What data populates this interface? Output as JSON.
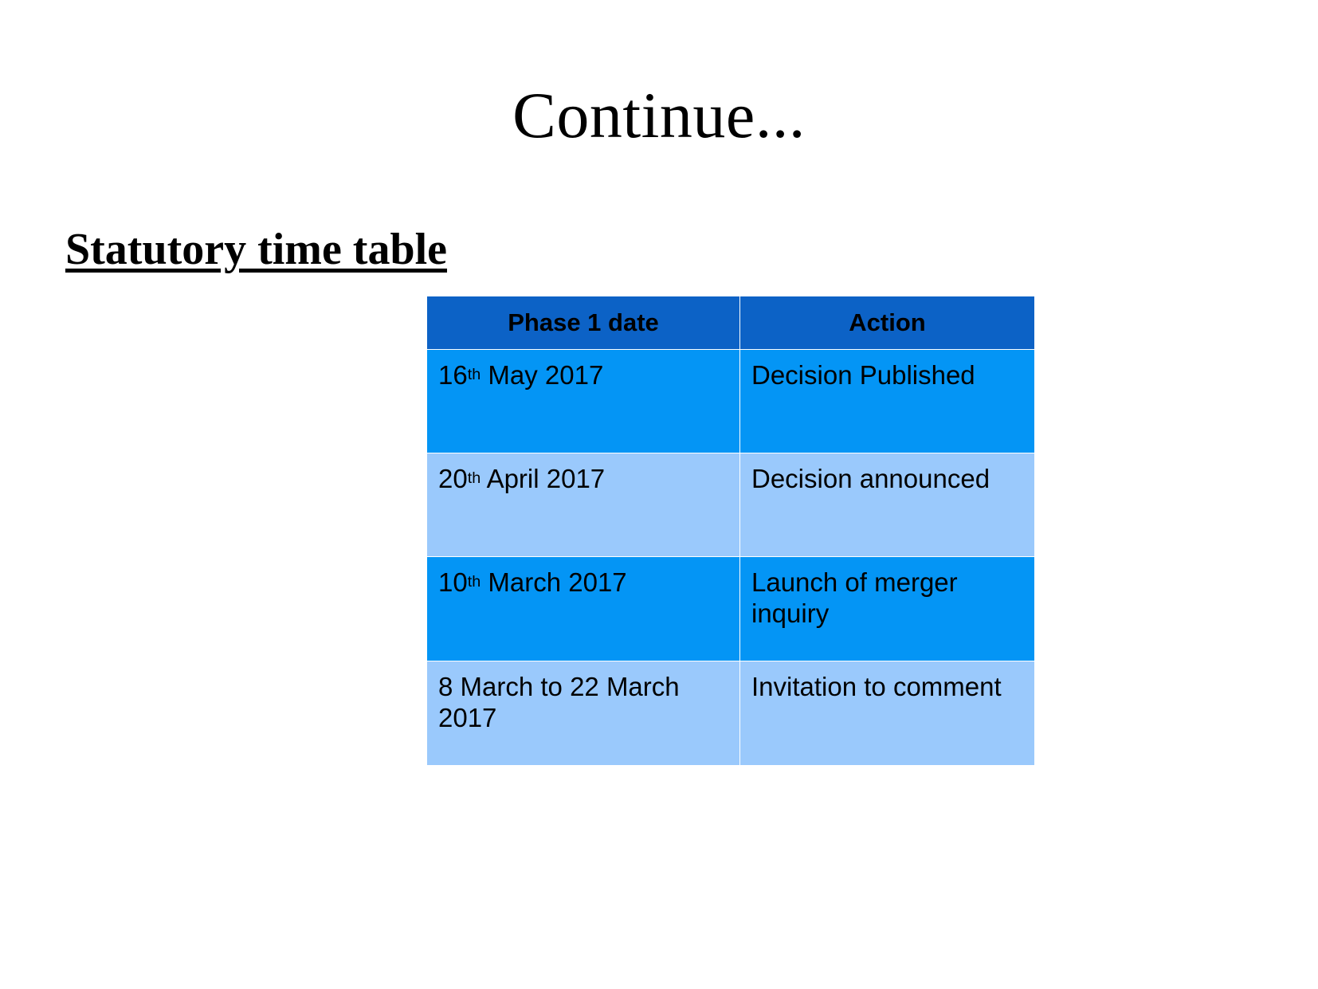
{
  "slide": {
    "title": "Continue...",
    "section_heading": "Statutory time table"
  },
  "table": {
    "columns": [
      "Phase 1 date",
      "Action"
    ],
    "rows": [
      {
        "date_number": "16",
        "date_ordinal": "th",
        "date_rest": " May 2017",
        "action": "Decision Published",
        "style": "dark"
      },
      {
        "date_number": "20",
        "date_ordinal": "th",
        "date_rest": " April 2017",
        "action": "Decision announced",
        "style": "light"
      },
      {
        "date_number": "10",
        "date_ordinal": "th",
        "date_rest": " March 2017",
        "action": "Launch of merger inquiry",
        "style": "dark"
      },
      {
        "date_number": "8 March to 22 March 2017",
        "date_ordinal": "",
        "date_rest": "",
        "action": "Invitation to comment",
        "style": "light"
      }
    ]
  },
  "colors": {
    "header_blue": "#0c62c6",
    "row_dark_blue": "#0495f5",
    "row_light_blue": "#9ac9fc",
    "background": "#ffffff",
    "text": "#000000"
  }
}
